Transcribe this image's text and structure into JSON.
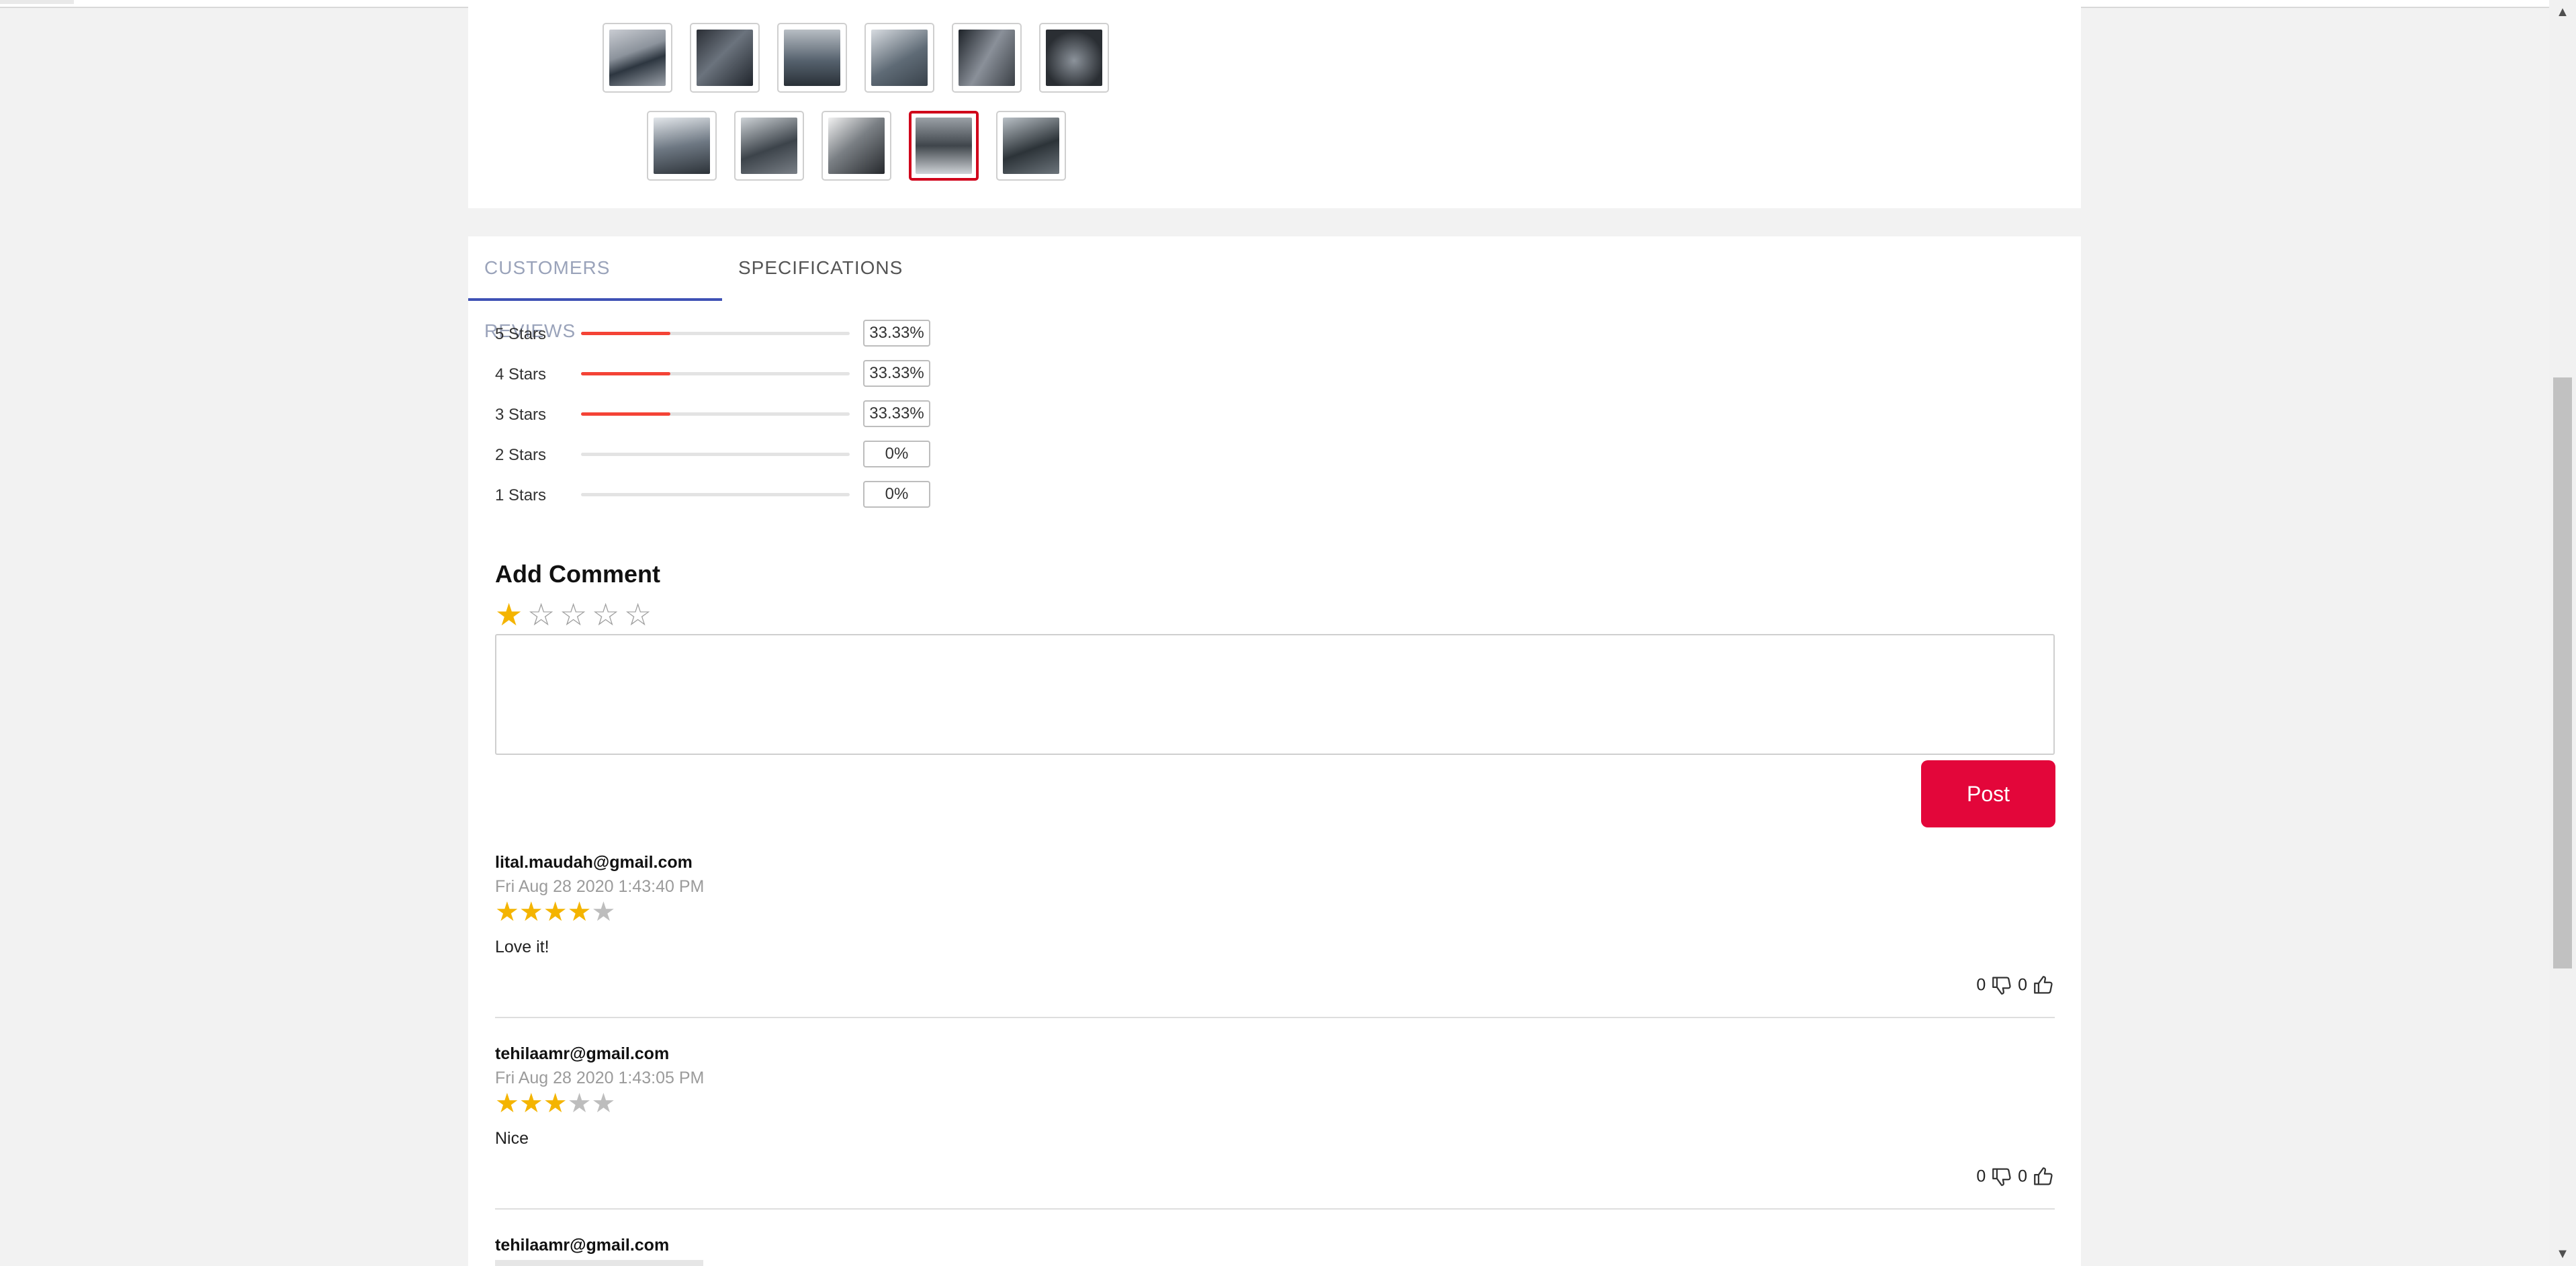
{
  "tabs": [
    {
      "label": "CUSTOMERS REVIEWS",
      "active": true
    },
    {
      "label": "SPECIFICATIONS",
      "active": false
    }
  ],
  "gallery": {
    "row1_count": 6,
    "row2_count": 5,
    "selected_index": 9
  },
  "rating_breakdown": [
    {
      "label": "5 Stars",
      "percent_text": "33.33%",
      "fraction": 0.3333
    },
    {
      "label": "4 Stars",
      "percent_text": "33.33%",
      "fraction": 0.3333
    },
    {
      "label": "3 Stars",
      "percent_text": "33.33%",
      "fraction": 0.3333
    },
    {
      "label": "2 Stars",
      "percent_text": "0%",
      "fraction": 0
    },
    {
      "label": "1 Stars",
      "percent_text": "0%",
      "fraction": 0
    }
  ],
  "add_comment": {
    "title": "Add Comment",
    "selected_rating": 1,
    "max_rating": 5,
    "comment_value": "",
    "post_label": "Post"
  },
  "reviews": [
    {
      "author": "lital.maudah@gmail.com",
      "date": "Fri Aug 28 2020 1:43:40 PM",
      "rating": 4,
      "text": "Love it!",
      "dislikes": "0",
      "likes": "0"
    },
    {
      "author": "tehilaamr@gmail.com",
      "date": "Fri Aug 28 2020 1:43:05 PM",
      "rating": 3,
      "text": "Nice",
      "dislikes": "0",
      "likes": "0"
    },
    {
      "author": "tehilaamr@gmail.com",
      "date": "",
      "rating": 0,
      "text": "",
      "dislikes": "",
      "likes": ""
    }
  ],
  "colors": {
    "accent_red": "#e3063a",
    "bar_red": "#f44336",
    "star_gold": "#f4b400",
    "tab_indicator": "#3f51b5"
  },
  "icons": {
    "dislike": "thumbs-down-icon",
    "like": "thumbs-up-icon",
    "star": "star-icon"
  }
}
